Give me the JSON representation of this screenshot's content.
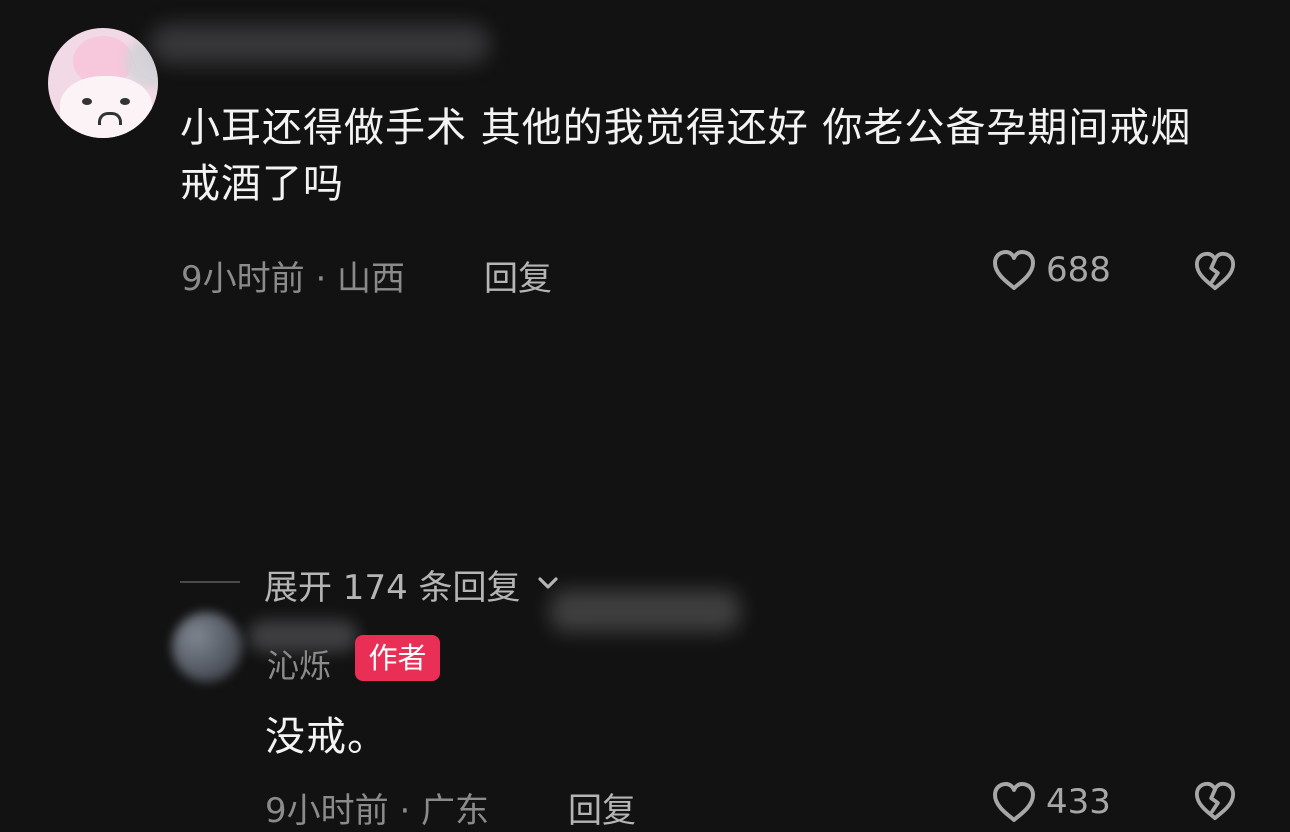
{
  "main_comment": {
    "text": "小耳还得做手术 其他的我觉得还好 你老公备孕期间戒烟戒酒了吗",
    "meta": "9小时前 · 山西",
    "reply_label": "回复",
    "like_count": "688"
  },
  "reply_comment": {
    "author_name": "沁烁",
    "author_badge": "作者",
    "text": "没戒。",
    "meta": "9小时前 · 广东",
    "reply_label": "回复",
    "like_count": "433"
  },
  "expand_replies": {
    "label": "展开 174 条回复"
  },
  "icons": {
    "like": "heart-outline-icon",
    "dislike": "broken-heart-icon",
    "expand": "chevron-down-icon"
  },
  "colors": {
    "background": "#121212",
    "primary_text": "#f3f3f3",
    "secondary_text": "#8b8b8b",
    "action_text": "#b5b5b5",
    "badge_background": "#ea2f56"
  }
}
